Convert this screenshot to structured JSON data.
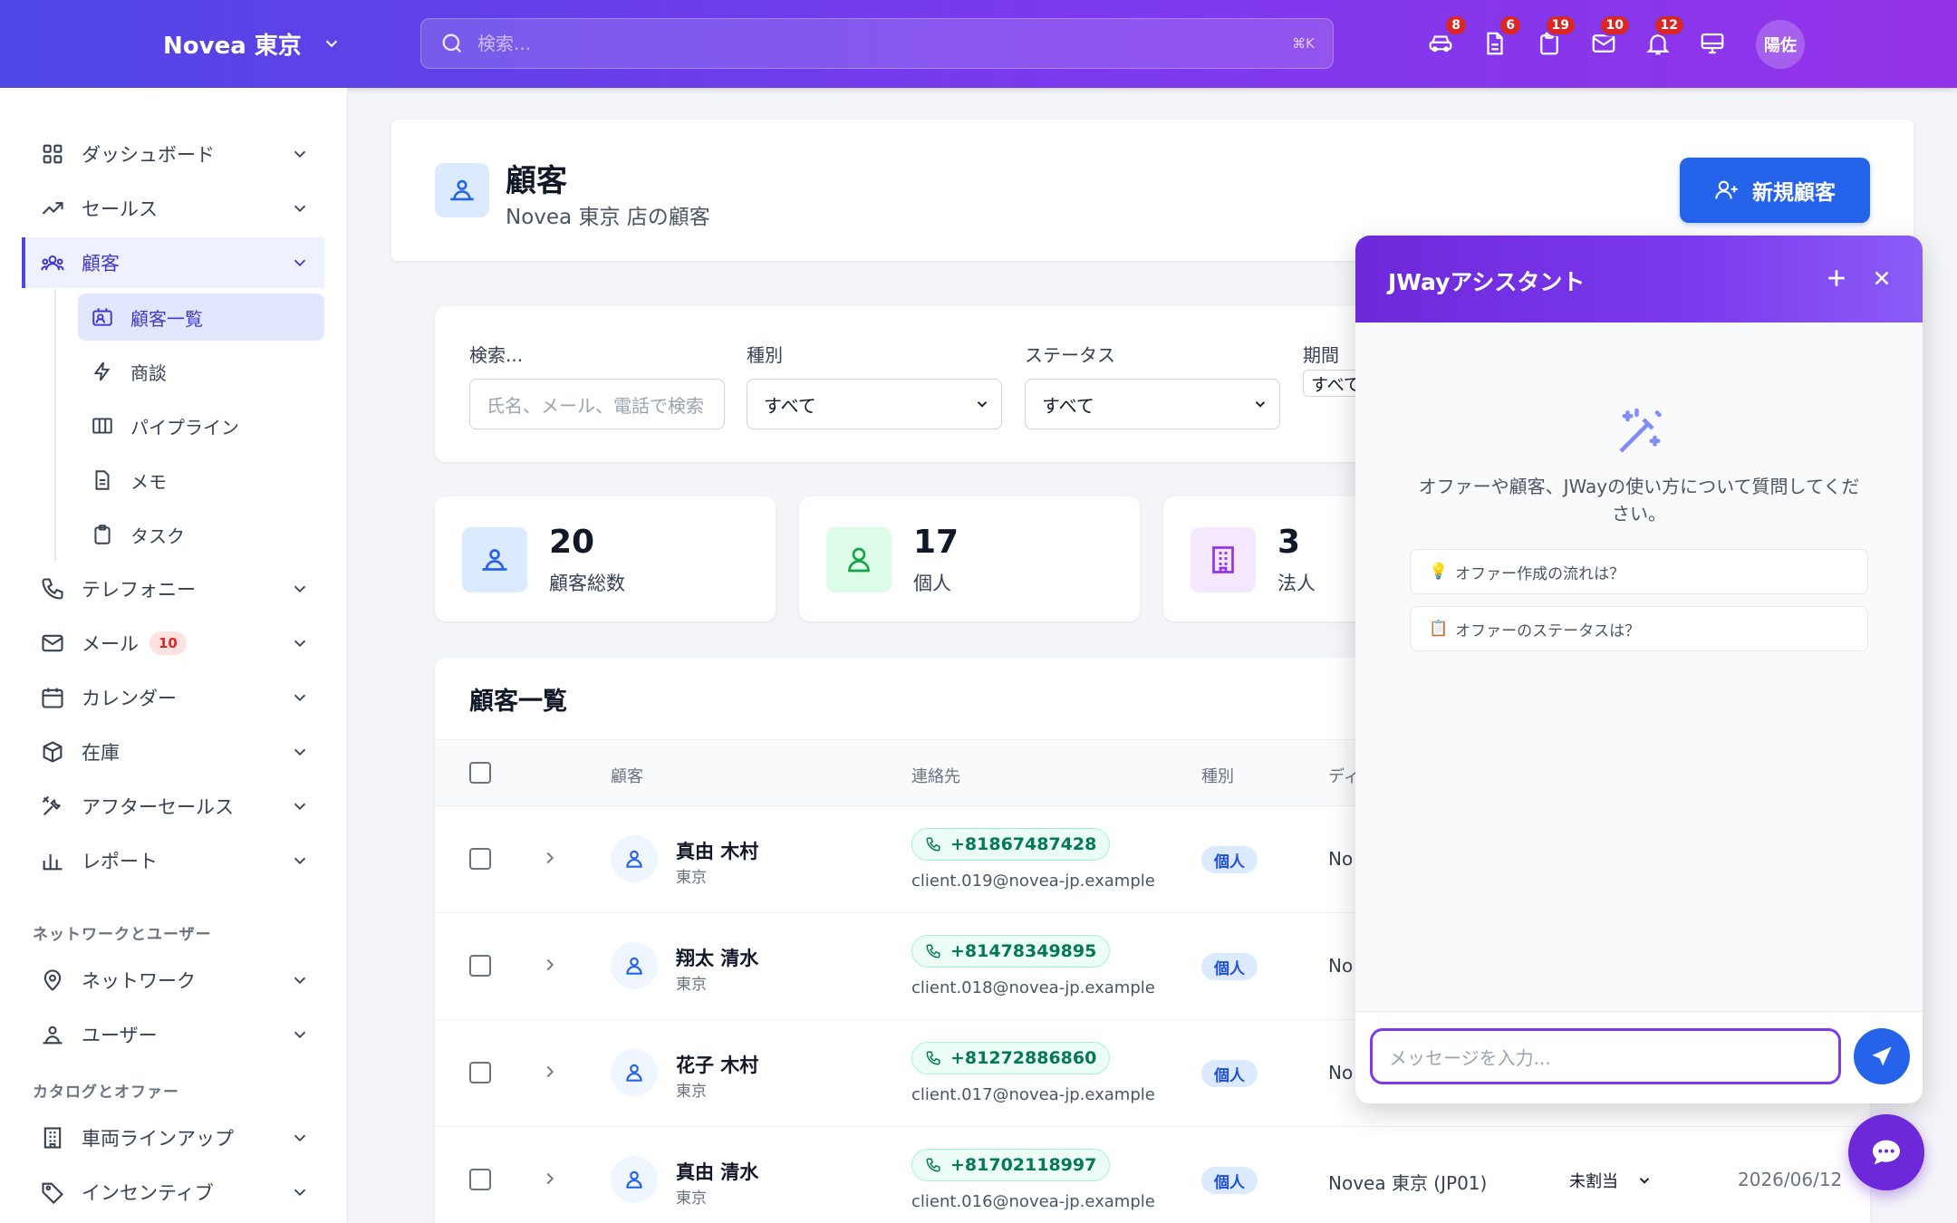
{
  "topbar": {
    "brand": "Novea 東京",
    "search_placeholder": "検索...",
    "search_shortcut": "⌘K",
    "icons": [
      {
        "name": "car-icon",
        "badge": "8"
      },
      {
        "name": "document-icon",
        "badge": "6"
      },
      {
        "name": "clipboard-icon",
        "badge": "19"
      },
      {
        "name": "mail-icon",
        "badge": "10"
      },
      {
        "name": "bell-icon",
        "badge": "12"
      },
      {
        "name": "monitor-icon",
        "badge": ""
      }
    ],
    "avatar": "陽佐"
  },
  "sidebar": {
    "items": [
      {
        "label": "ダッシュボード",
        "icon": "grid-icon"
      },
      {
        "label": "セールス",
        "icon": "trending-up-icon"
      },
      {
        "label": "顧客",
        "icon": "users-icon",
        "active": true
      },
      {
        "label": "テレフォニー",
        "icon": "phone-icon"
      },
      {
        "label": "メール",
        "icon": "mail-icon",
        "badge": "10"
      },
      {
        "label": "カレンダー",
        "icon": "calendar-icon"
      },
      {
        "label": "在庫",
        "icon": "box-icon"
      },
      {
        "label": "アフターセールス",
        "icon": "tools-icon"
      },
      {
        "label": "レポート",
        "icon": "bar-chart-icon"
      }
    ],
    "sub_items": [
      {
        "label": "顧客一覧",
        "icon": "contact-card-icon",
        "active": true
      },
      {
        "label": "商談",
        "icon": "bolt-icon"
      },
      {
        "label": "パイプライン",
        "icon": "columns-icon"
      },
      {
        "label": "メモ",
        "icon": "note-icon"
      },
      {
        "label": "タスク",
        "icon": "clipboard-icon"
      }
    ],
    "section_network": "ネットワークとユーザー",
    "network_items": [
      {
        "label": "ネットワーク",
        "icon": "map-pin-icon"
      },
      {
        "label": "ユーザー",
        "icon": "user-group-icon"
      }
    ],
    "section_catalog": "カタログとオファー",
    "catalog_items": [
      {
        "label": "車両ラインアップ",
        "icon": "building-icon"
      },
      {
        "label": "インセンティブ",
        "icon": "tag-icon"
      }
    ]
  },
  "header": {
    "title": "顧客",
    "subtitle": "Novea 東京 店の顧客",
    "new_button": "新規顧客"
  },
  "filters": {
    "search_label": "検索...",
    "search_placeholder": "氏名、メール、電話で検索",
    "type_label": "種別",
    "type_value": "すべて",
    "status_label": "ステータス",
    "status_value": "すべて",
    "period_label": "期間",
    "period_value": "すべて"
  },
  "stats": [
    {
      "value": "20",
      "label": "顧客総数",
      "color": "#2563eb",
      "bg": "#dbeafe"
    },
    {
      "value": "17",
      "label": "個人",
      "color": "#16a34a",
      "bg": "#dcfce7"
    },
    {
      "value": "3",
      "label": "法人",
      "color": "#9333ea",
      "bg": "#f3e8ff"
    }
  ],
  "table": {
    "title": "顧客一覧",
    "columns": {
      "customer": "顧客",
      "contact": "連絡先",
      "type": "種別",
      "dealer": "ディ"
    },
    "rows": [
      {
        "name": "真由 木村",
        "city": "東京",
        "phone": "+81867487428",
        "email": "client.019@novea-jp.example",
        "type": "個人",
        "dealer": "No"
      },
      {
        "name": "翔太 清水",
        "city": "東京",
        "phone": "+81478349895",
        "email": "client.018@novea-jp.example",
        "type": "個人",
        "dealer": "No"
      },
      {
        "name": "花子 木村",
        "city": "東京",
        "phone": "+81272886860",
        "email": "client.017@novea-jp.example",
        "type": "個人",
        "dealer": "No"
      },
      {
        "name": "真由 清水",
        "city": "東京",
        "phone": "+81702118997",
        "email": "client.016@novea-jp.example",
        "type": "個人",
        "dealer": "Novea 東京 (JP01)",
        "assignee": "未割当",
        "date": "2026/06/12"
      }
    ]
  },
  "chat": {
    "title": "JWayアシスタント",
    "intro": "オファーや顧客、JWayの使い方について質問してください。",
    "suggestions": [
      {
        "emoji": "💡",
        "text": "オファー作成の流れは？"
      },
      {
        "emoji": "📋",
        "text": "オファーのステータスは？"
      }
    ],
    "input_placeholder": "メッセージを入力..."
  }
}
